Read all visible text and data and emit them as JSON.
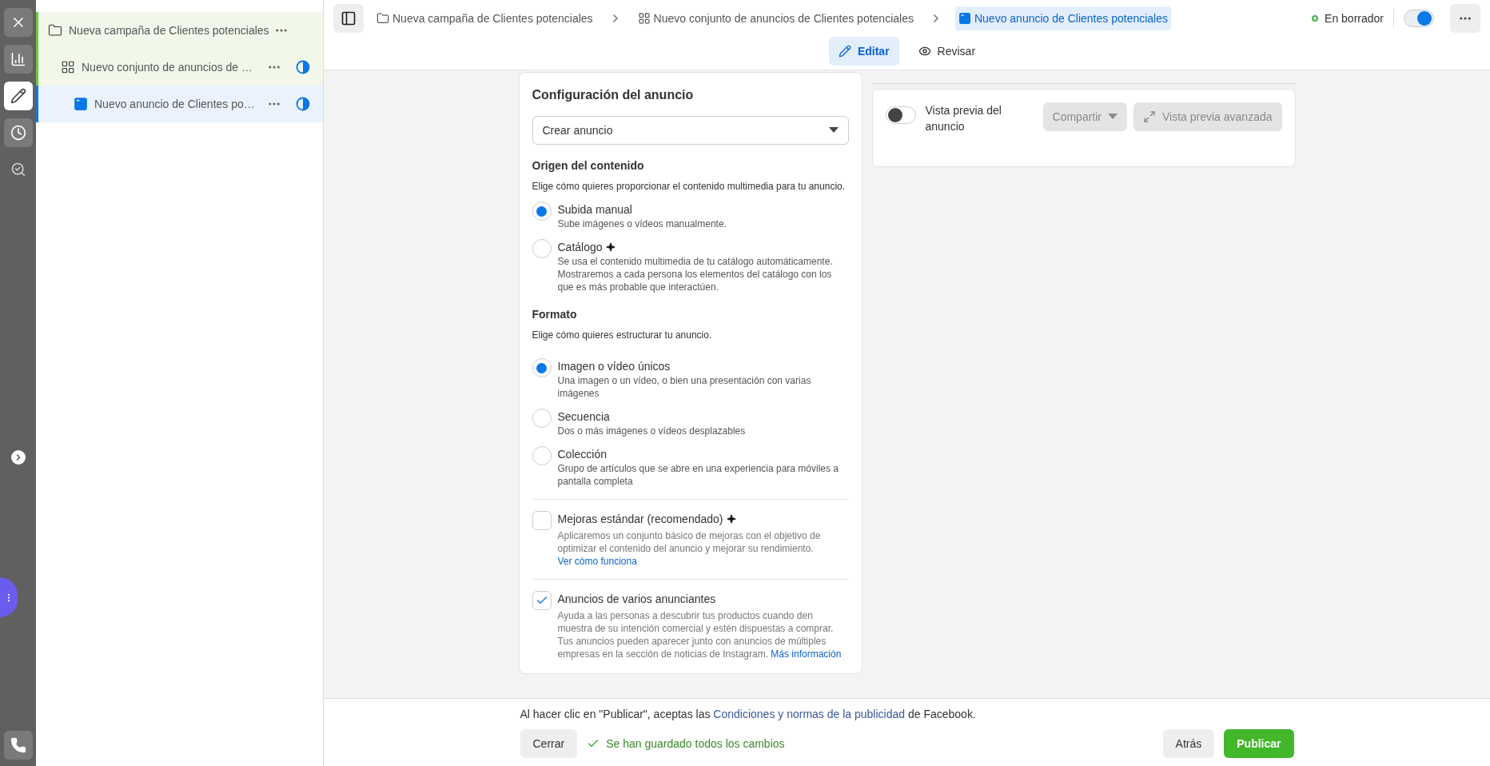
{
  "rail_tabs": [
    {
      "selected": false
    },
    {
      "selected": false
    },
    {
      "selected": true
    },
    {
      "selected": false
    },
    {
      "selected": false
    }
  ],
  "tree": [
    {
      "kind": "campaign",
      "label": "Nueva campaña de Clientes potenciales",
      "selected": false,
      "status_icon": false,
      "children": [
        {
          "kind": "adset",
          "label": "Nuevo conjunto de anuncios de …",
          "selected": false,
          "status_icon": true,
          "children": [
            {
              "kind": "ad",
              "label": "Nuevo anuncio de Clientes po…",
              "selected": true,
              "status_icon": true
            }
          ]
        }
      ]
    }
  ],
  "breadcrumbs": [
    {
      "kind": "campaign",
      "label": "Nueva campaña de Clientes potenciales",
      "selected": false
    },
    {
      "kind": "adset",
      "label": "Nuevo conjunto de anuncios de Clientes potenciales",
      "selected": false
    },
    {
      "kind": "ad",
      "label": "Nuevo anuncio de Clientes potenciales",
      "selected": true
    }
  ],
  "status": {
    "label": "En borrador",
    "on": true
  },
  "mode_tabs": [
    {
      "kind": "edit",
      "label": "Editar",
      "selected": true
    },
    {
      "kind": "review",
      "label": "Revisar",
      "selected": false
    }
  ],
  "form": {
    "title": "Configuración del anuncio",
    "dropdown": "Crear anuncio",
    "sections": [
      {
        "title": "Origen del contenido",
        "subtitle": "Elige cómo quieres proporcionar el contenido multimedia para tu anuncio.",
        "options": [
          {
            "label": "Subida manual",
            "description": "Sube imágenes o vídeos manualmente.",
            "selected": true,
            "sparkle": false
          },
          {
            "label": "Catálogo",
            "description": "Se usa el contenido multimedia de tu catálogo automáticamente. Mostraremos a cada persona los elementos del catálogo con los que es más probable que interactúen.",
            "selected": false,
            "sparkle": true
          }
        ]
      },
      {
        "title": "Formato",
        "subtitle": "Elige cómo quieres estructurar tu anuncio.",
        "options": [
          {
            "label": "Imagen o vídeo únicos",
            "description": "Una imagen o un vídeo, o bien una presentación con varias imágenes",
            "selected": true,
            "sparkle": false
          },
          {
            "label": "Secuencia",
            "description": "Dos o más imágenes o vídeos desplazables",
            "selected": false,
            "sparkle": false
          },
          {
            "label": "Colección",
            "description": "Grupo de artículos que se abre en una experiencia para móviles a pantalla completa",
            "selected": false,
            "sparkle": false
          }
        ]
      }
    ],
    "checkboxes": [
      {
        "label": "Mejoras estándar (recomendado)",
        "sparkle": true,
        "checked": false,
        "description": "Aplicaremos un conjunto básico de mejoras con el objetivo de optimizar el contenido del anuncio y mejorar su rendimiento.",
        "link": "Ver cómo funciona"
      },
      {
        "label": "Anuncios de varios anunciantes",
        "sparkle": false,
        "checked": true,
        "description": "Ayuda a las personas a descubrir tus productos cuando den muestra de su intención comercial y estén dispuestas a comprar. Tus anuncios pueden aparecer junto con anuncios de múltiples empresas en la sección de noticias de Instagram.",
        "link": "Más información"
      }
    ]
  },
  "preview": {
    "toggle_label": "Vista previa del anuncio",
    "on": false,
    "buttons": [
      {
        "kind": "share",
        "label": "Compartir",
        "disabled": true
      },
      {
        "kind": "advanced",
        "label": "Vista previa avanzada",
        "disabled": true
      }
    ]
  },
  "footer": {
    "terms_before": "Al hacer clic en \"Publicar\", aceptas las",
    "terms_link": "Condiciones y normas de la publicidad",
    "terms_after": "de Facebook.",
    "close": "Cerrar",
    "saved": "Se han guardado todos los cambios",
    "back": "Atrás",
    "publish": "Publicar"
  }
}
